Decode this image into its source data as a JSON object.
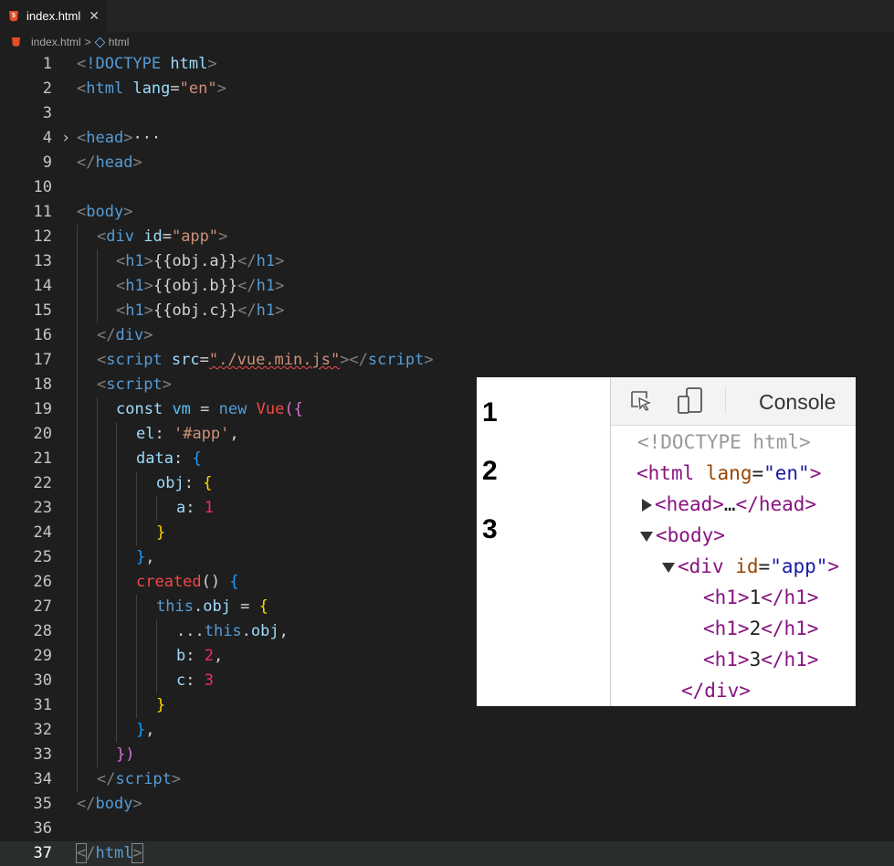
{
  "tab": {
    "file_name": "index.html",
    "close_symbol": "✕"
  },
  "breadcrumb": {
    "file": "index.html",
    "sep": ">",
    "node": "html"
  },
  "code_lines": [
    {
      "n": "1"
    },
    {
      "n": "2"
    },
    {
      "n": "3"
    },
    {
      "n": "4"
    },
    {
      "n": "9"
    },
    {
      "n": "10"
    },
    {
      "n": "11"
    },
    {
      "n": "12"
    },
    {
      "n": "13"
    },
    {
      "n": "14"
    },
    {
      "n": "15"
    },
    {
      "n": "16"
    },
    {
      "n": "17"
    },
    {
      "n": "18"
    },
    {
      "n": "19"
    },
    {
      "n": "20"
    },
    {
      "n": "21"
    },
    {
      "n": "22"
    },
    {
      "n": "23"
    },
    {
      "n": "24"
    },
    {
      "n": "25"
    },
    {
      "n": "26"
    },
    {
      "n": "27"
    },
    {
      "n": "28"
    },
    {
      "n": "29"
    },
    {
      "n": "30"
    },
    {
      "n": "31"
    },
    {
      "n": "32"
    },
    {
      "n": "33"
    },
    {
      "n": "34"
    },
    {
      "n": "35"
    },
    {
      "n": "36"
    },
    {
      "n": "37"
    }
  ],
  "code_text": {
    "doctype": "!DOCTYPE",
    "html": "html",
    "lang_attr": "lang",
    "lang_val": "\"en\"",
    "head": "head",
    "ellipsis": "···",
    "body": "body",
    "div": "div",
    "id_attr": "id",
    "app_val": "\"app\"",
    "h1": "h1",
    "obj_a": "{{obj.a}}",
    "obj_b": "{{obj.b}}",
    "obj_c": "{{obj.c}}",
    "script": "script",
    "src_attr": "src",
    "src_val": "\"./vue.min.js\"",
    "const": "const",
    "vm": "vm",
    "eq": "=",
    "new": "new",
    "vue": "Vue",
    "el": "el",
    "app_str": "'#app'",
    "data": "data",
    "obj": "obj",
    "a": "a",
    "one": "1",
    "created": "created",
    "this": "this",
    "b": "b",
    "two": "2",
    "c": "c",
    "three": "3",
    "spread": "..."
  },
  "preview": {
    "h1_values": [
      "1",
      "2",
      "3"
    ]
  },
  "devtools": {
    "console_tab": "Console",
    "doctype": "<!DOCTYPE html>",
    "html_open": "html",
    "lang": "lang",
    "lang_val": "\"en\"",
    "head": "head",
    "head_ellipsis": "…",
    "body": "body",
    "div": "div",
    "id": "id",
    "app": "\"app\"",
    "h1_items": [
      "1",
      "2",
      "3"
    ]
  }
}
